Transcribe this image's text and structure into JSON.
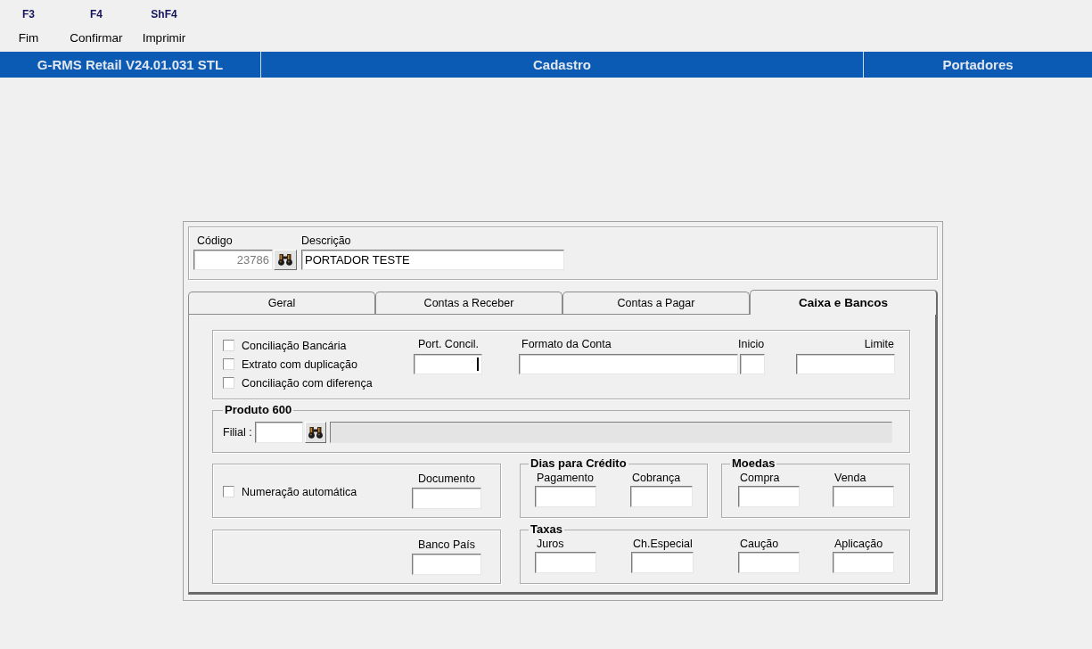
{
  "toolbar": [
    {
      "key": "F3",
      "label": "Fim"
    },
    {
      "key": "F4",
      "label": "Confirmar"
    },
    {
      "key": "ShF4",
      "label": "Imprimir"
    }
  ],
  "title_bar": {
    "sections": [
      "G-RMS Retail V24.01.031 STL",
      "Cadastro",
      "Portadores"
    ]
  },
  "header": {
    "code": {
      "label": "Código",
      "value": "23786",
      "disabled": true
    },
    "description": {
      "label": "Descrição",
      "value": "PORTADOR TESTE",
      "disabled": false
    }
  },
  "tabs": [
    {
      "label": "Geral",
      "selected": false
    },
    {
      "label": "Contas a Receber",
      "selected": false
    },
    {
      "label": "Contas a Pagar",
      "selected": false
    },
    {
      "label": "Caixa e Bancos",
      "selected": true
    }
  ],
  "conciliacao": {
    "checkboxes": [
      {
        "label": "Conciliação Bancária",
        "checked": false
      },
      {
        "label": "Extrato com duplicação",
        "checked": false
      },
      {
        "label": "Conciliação com diferença",
        "checked": false
      }
    ],
    "fields": [
      {
        "label": "Port. Concil.",
        "focused": true
      },
      {
        "label": "Formato da Conta",
        "focused": false
      },
      {
        "label": "Inicio",
        "focused": false
      },
      {
        "label": "Limite",
        "focused": false
      }
    ]
  },
  "produto_600": {
    "title": "Produto 600",
    "filial": {
      "label": "Filial :"
    },
    "name_field": {
      "disabled": true
    }
  },
  "numeracao": {
    "checkbox": {
      "label": "Numeração automática",
      "checked": false
    },
    "field": {
      "label": "Documento"
    }
  },
  "dias_para_credito": {
    "title": "Dias para Crédito",
    "fields": [
      {
        "label": "Pagamento"
      },
      {
        "label": "Cobrança"
      }
    ]
  },
  "moedas": {
    "title": "Moedas",
    "fields": [
      {
        "label": "Compra"
      },
      {
        "label": "Venda"
      }
    ]
  },
  "banco": {
    "field": {
      "label": "Banco País"
    }
  },
  "taxas": {
    "title": "Taxas",
    "fields": [
      {
        "label": "Juros"
      },
      {
        "label": "Ch.Especial"
      },
      {
        "label": "Caução"
      },
      {
        "label": "Aplicação"
      }
    ]
  }
}
